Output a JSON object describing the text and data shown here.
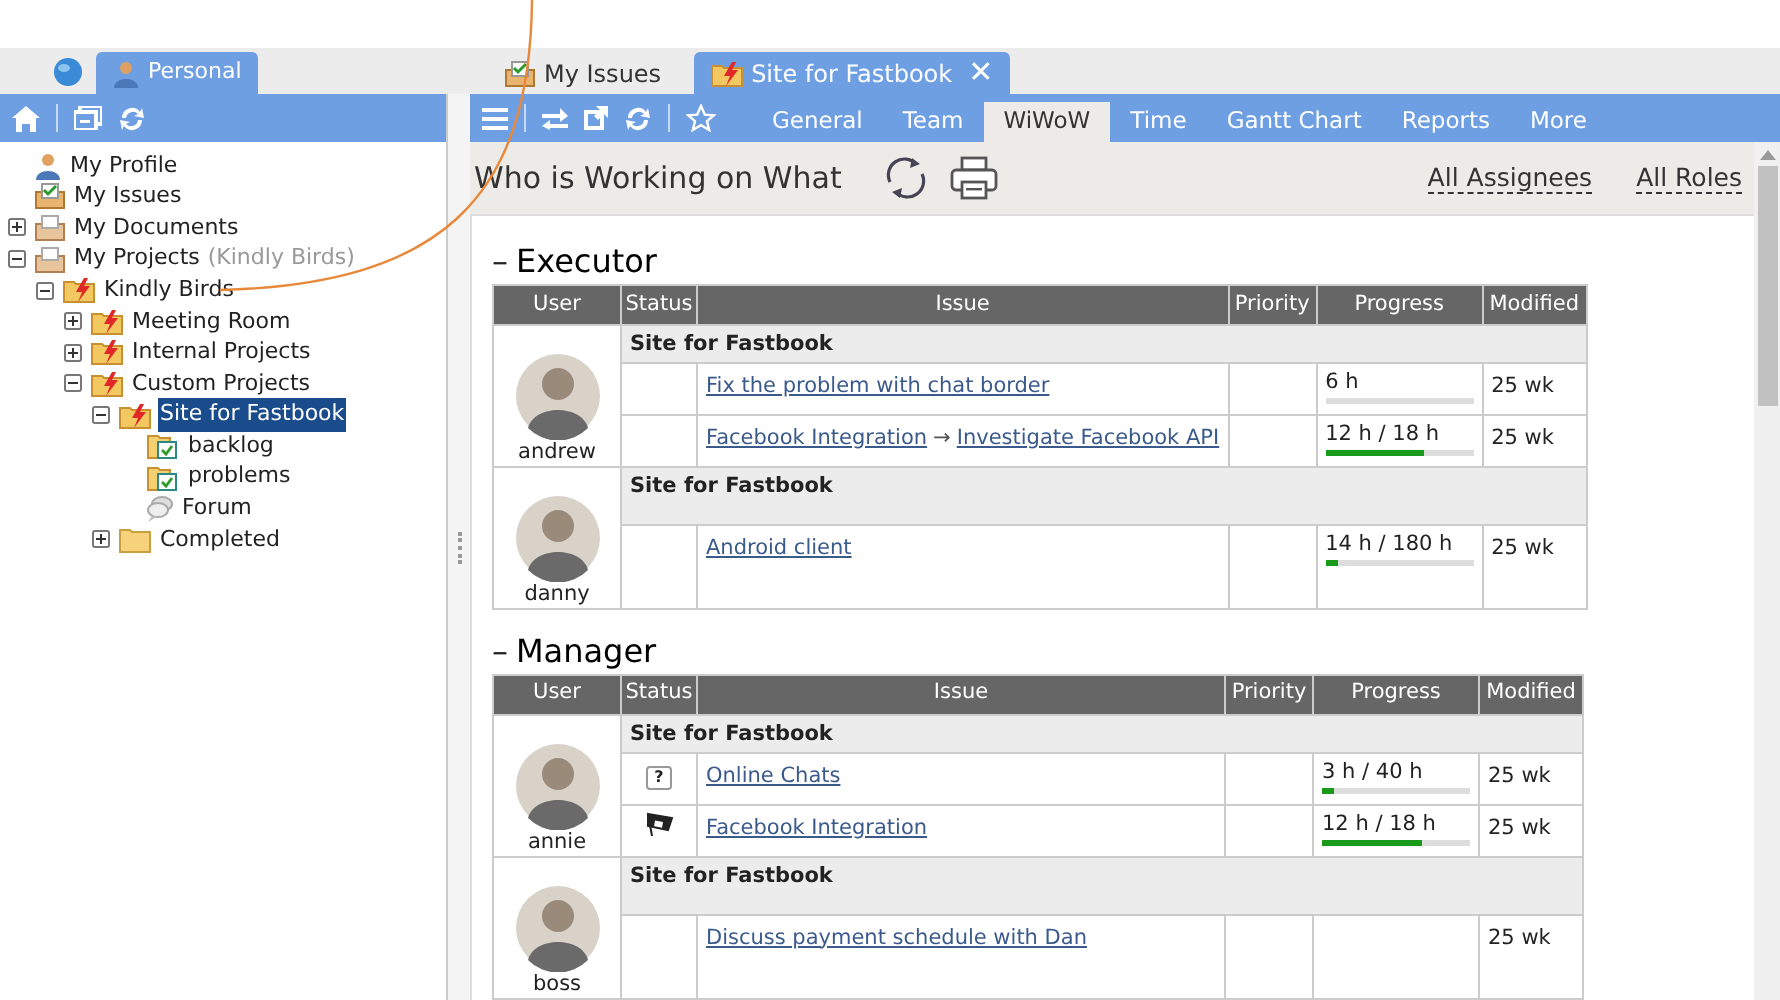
{
  "workspace_tabs": [
    {
      "label": "Personal",
      "kind": "person",
      "selected": true
    }
  ],
  "tree": [
    {
      "label": "My Profile",
      "kind": "person",
      "selected": false
    },
    {
      "label": "My Issues",
      "kind": "issues",
      "selected": false
    },
    {
      "label": "My Documents",
      "kind": "documents",
      "expanded": false,
      "selected": false
    },
    {
      "label": "My Projects",
      "note": "(Kindly Birds)",
      "kind": "documents",
      "expanded": true,
      "selected": false,
      "children": [
        {
          "label": "Kindly Birds",
          "kind": "project",
          "expanded": true,
          "selected": false,
          "children": [
            {
              "label": "Meeting Room",
              "kind": "project",
              "expanded": false,
              "selected": false
            },
            {
              "label": "Internal Projects",
              "kind": "project",
              "expanded": false,
              "selected": false
            },
            {
              "label": "Custom Projects",
              "kind": "project",
              "expanded": true,
              "selected": false,
              "children": [
                {
                  "label": "Site for Fastbook",
                  "kind": "project",
                  "expanded": true,
                  "selected": true,
                  "children": [
                    {
                      "label": "backlog",
                      "kind": "checklist",
                      "selected": false
                    },
                    {
                      "label": "problems",
                      "kind": "checklist",
                      "selected": false
                    },
                    {
                      "label": "Forum",
                      "kind": "forum",
                      "selected": false
                    }
                  ]
                },
                {
                  "label": "Completed",
                  "kind": "folder",
                  "expanded": false,
                  "selected": false
                }
              ]
            }
          ]
        }
      ]
    }
  ],
  "doc_tabs": [
    {
      "label": "My Issues",
      "kind": "issues",
      "selected": false
    },
    {
      "label": "Site for Fastbook",
      "kind": "project",
      "selected": true,
      "close": "✕"
    }
  ],
  "view_tabs": [
    {
      "label": "General",
      "selected": false
    },
    {
      "label": "Team",
      "selected": false
    },
    {
      "label": "WiWoW",
      "selected": true
    },
    {
      "label": "Time",
      "selected": false
    },
    {
      "label": "Gantt Chart",
      "selected": false
    },
    {
      "label": "Reports",
      "selected": false
    },
    {
      "label": "More",
      "selected": false
    }
  ],
  "page_title": "Who is Working on What",
  "filters": [
    "All Assignees",
    "All Roles"
  ],
  "sections": [
    {
      "toggle": "–",
      "title": "Executor",
      "columns": [
        "User",
        "Status",
        "Issue",
        "Priority",
        "Progress",
        "Modified"
      ],
      "users": [
        {
          "name": "andrew",
          "project": "Site for Fastbook",
          "issues": [
            {
              "title": "Fix the problem with chat border",
              "progress": "6 h",
              "level": 0,
              "modified": "25 wk"
            },
            {
              "parent": "Facebook Integration",
              "arrow": "→",
              "title": "Investigate Facebook API",
              "progress": "12 h / 18 h",
              "level": 0.67,
              "modified": "25 wk"
            }
          ]
        },
        {
          "name": "danny",
          "project": "Site for Fastbook",
          "issues": [
            {
              "title": "Android client",
              "progress": "14 h / 180 h",
              "level": 0.08,
              "modified": "25 wk"
            }
          ]
        }
      ]
    },
    {
      "toggle": "–",
      "title": "Manager",
      "columns": [
        "User",
        "Status",
        "Issue",
        "Priority",
        "Progress",
        "Modified"
      ],
      "users": [
        {
          "name": "annie",
          "project": "Site for Fastbook",
          "issues": [
            {
              "kind": "question",
              "status_mark": "?",
              "title": "Online Chats",
              "progress": "3 h / 40 h",
              "level": 0.08,
              "modified": "25 wk"
            },
            {
              "kind": "flag",
              "title": "Facebook Integration",
              "progress": "12 h / 18 h",
              "level": 0.67,
              "modified": "25 wk"
            }
          ]
        },
        {
          "name": "boss",
          "project": "Site for Fastbook",
          "issues": [
            {
              "title": "Discuss payment schedule with Dan",
              "modified": "25 wk"
            }
          ]
        }
      ]
    }
  ]
}
